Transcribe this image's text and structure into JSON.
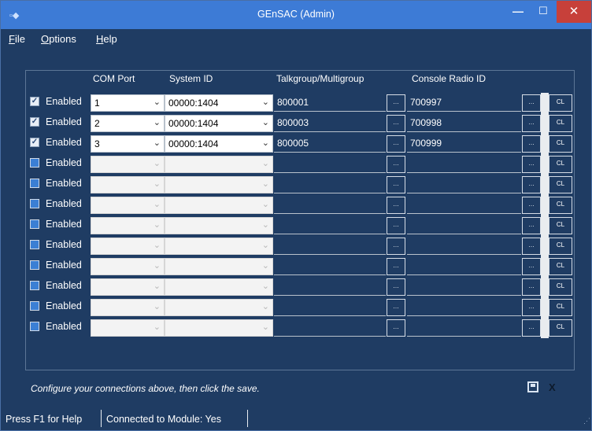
{
  "window": {
    "title": "GEnSAC (Admin)",
    "app_icon": "app-icon",
    "controls": {
      "minimize": "—",
      "maximize": "☐",
      "close": "✕"
    }
  },
  "menu": [
    "File",
    "Options",
    "Help"
  ],
  "headers": {
    "com_port": "COM Port",
    "system_id": "System ID",
    "talkgroup": "Talkgroup/Multigroup",
    "console_radio_id": "Console Radio ID"
  },
  "enabled_label": "Enabled",
  "dots_label": "...",
  "cl_label": "CL",
  "rows": [
    {
      "enabled": true,
      "com_port": "1",
      "system_id": "00000:1404",
      "talkgroup": "800001",
      "console_radio_id": "700997"
    },
    {
      "enabled": true,
      "com_port": "2",
      "system_id": "00000:1404",
      "talkgroup": "800003",
      "console_radio_id": "700998"
    },
    {
      "enabled": true,
      "com_port": "3",
      "system_id": "00000:1404",
      "talkgroup": "800005",
      "console_radio_id": "700999"
    },
    {
      "enabled": false,
      "com_port": "",
      "system_id": "",
      "talkgroup": "",
      "console_radio_id": ""
    },
    {
      "enabled": false,
      "com_port": "",
      "system_id": "",
      "talkgroup": "",
      "console_radio_id": ""
    },
    {
      "enabled": false,
      "com_port": "",
      "system_id": "",
      "talkgroup": "",
      "console_radio_id": ""
    },
    {
      "enabled": false,
      "com_port": "",
      "system_id": "",
      "talkgroup": "",
      "console_radio_id": ""
    },
    {
      "enabled": false,
      "com_port": "",
      "system_id": "",
      "talkgroup": "",
      "console_radio_id": ""
    },
    {
      "enabled": false,
      "com_port": "",
      "system_id": "",
      "talkgroup": "",
      "console_radio_id": ""
    },
    {
      "enabled": false,
      "com_port": "",
      "system_id": "",
      "talkgroup": "",
      "console_radio_id": ""
    },
    {
      "enabled": false,
      "com_port": "",
      "system_id": "",
      "talkgroup": "",
      "console_radio_id": ""
    },
    {
      "enabled": false,
      "com_port": "",
      "system_id": "",
      "talkgroup": "",
      "console_radio_id": ""
    }
  ],
  "hint": "Configure your connections above, then click the save.",
  "actions": {
    "save_icon": "save-icon",
    "cancel_icon": "X"
  },
  "status": {
    "help": "Press F1 for Help",
    "connection": "Connected to Module: Yes"
  },
  "colors": {
    "background": "#1f3c63",
    "titlebar": "#3d7bd6",
    "close": "#c7403a"
  }
}
